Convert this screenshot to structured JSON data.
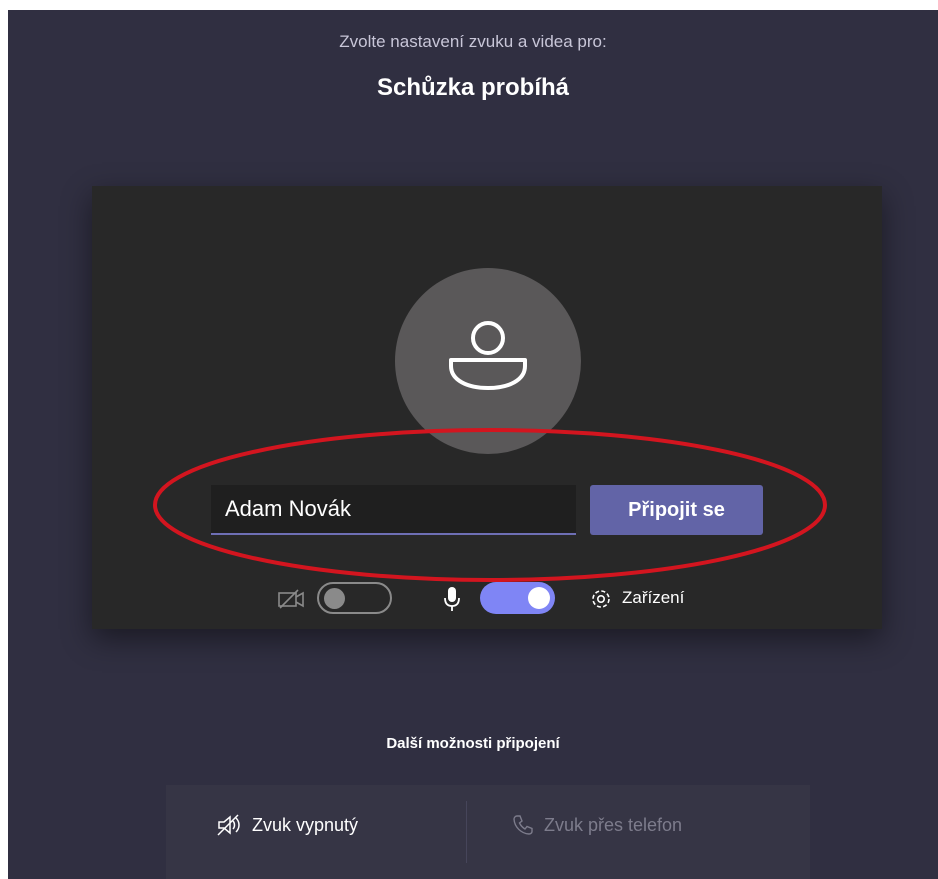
{
  "header": {
    "subtitle": "Zvolte nastavení zvuku a videa pro:",
    "meeting_title": "Schůzka probíhá"
  },
  "preview": {
    "name_value": "Adam Novák",
    "join_label": "Připojit se",
    "camera": {
      "icon": "camera-off-icon",
      "enabled": false
    },
    "microphone": {
      "icon": "microphone-icon",
      "enabled": true
    },
    "devices_label": "Zařízení"
  },
  "more_options": {
    "heading": "Další možnosti připojení",
    "audio_off_label": "Zvuk vypnutý",
    "phone_audio_label": "Zvuk přes telefon"
  },
  "colors": {
    "background": "#302f41",
    "preview_bg": "#282828",
    "accent": "#6264a7",
    "toggle_on": "#7f85f5",
    "annotation": "#d3151f"
  }
}
